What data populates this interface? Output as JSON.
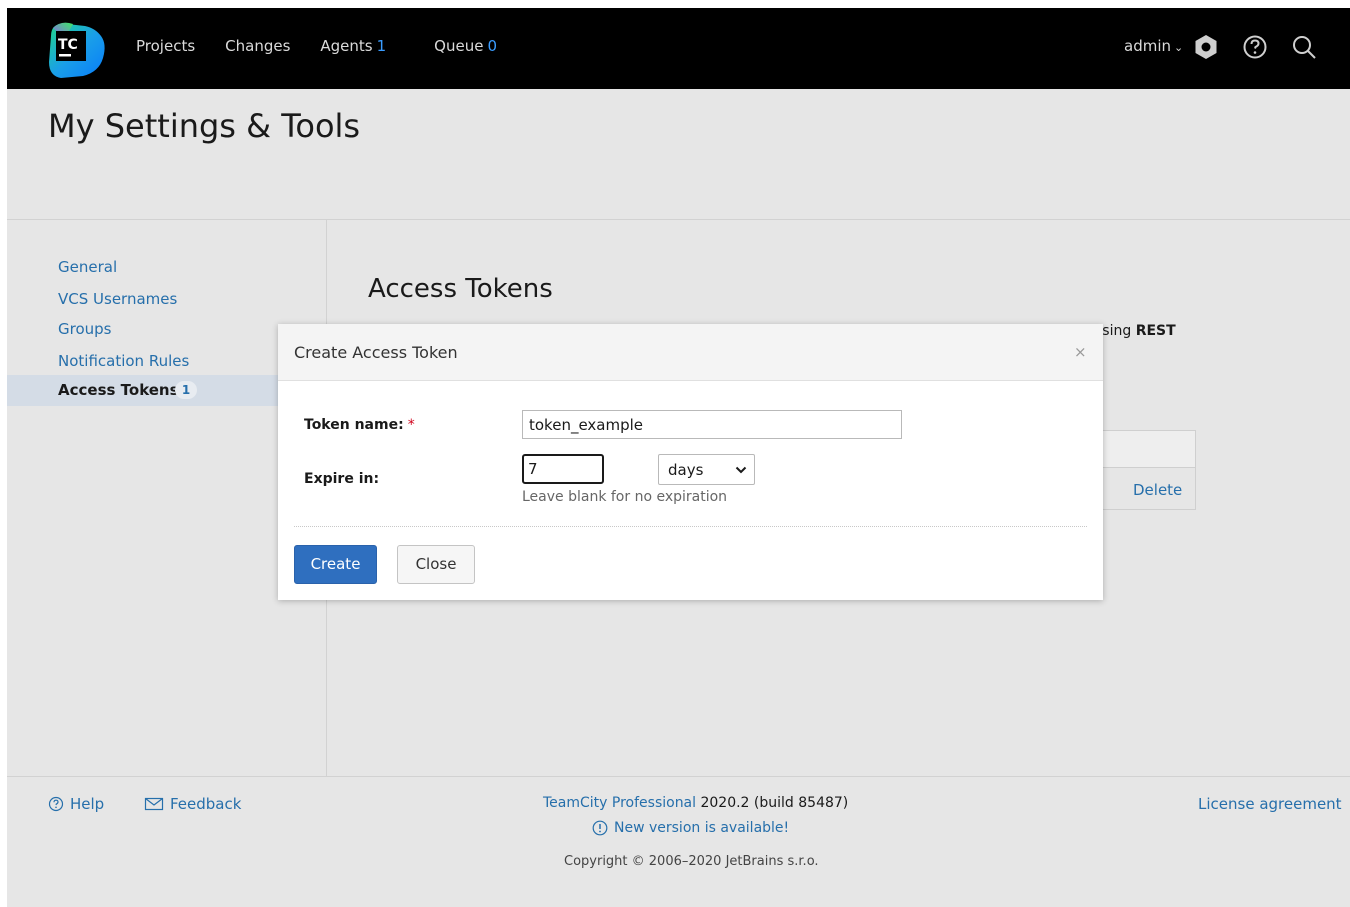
{
  "header": {
    "logo_text": "TC",
    "nav": [
      {
        "label": "Projects",
        "count": ""
      },
      {
        "label": "Changes",
        "count": ""
      },
      {
        "label": "Agents",
        "count": "1"
      },
      {
        "label": "Queue",
        "count": "0"
      }
    ],
    "user": "admin",
    "icons": [
      "agent-hexagon-icon",
      "help-icon",
      "search-icon"
    ],
    "colors": {
      "bar": "#000000",
      "count": "#3a9cff"
    }
  },
  "page": {
    "title": "My Settings & Tools"
  },
  "sidebar": {
    "items": [
      {
        "label": "General"
      },
      {
        "label": "VCS Usernames"
      },
      {
        "label": "Groups"
      },
      {
        "label": "Notification Rules"
      }
    ],
    "active": {
      "label": "Access Tokens",
      "badge": "1"
    }
  },
  "main": {
    "title": "Access Tokens",
    "desc_fragment": "ssing",
    "desc_bold": "REST",
    "table_action": "Delete"
  },
  "modal": {
    "title": "Create Access Token",
    "close_glyph": "×",
    "token_label": "Token name:",
    "required_mark": "*",
    "token_value": "token_example",
    "expire_label": "Expire in:",
    "expire_value": "7",
    "unit_selected": "days",
    "hint": "Leave blank for no expiration",
    "create_label": "Create",
    "close_label": "Close"
  },
  "footer": {
    "help": "Help",
    "feedback": "Feedback",
    "product_link": "TeamCity Professional",
    "version": " 2020.2 (build 85487)",
    "new_version": "New version is available!",
    "copyright": "Copyright © 2006–2020 JetBrains s.r.o.",
    "license": "License agreement"
  }
}
